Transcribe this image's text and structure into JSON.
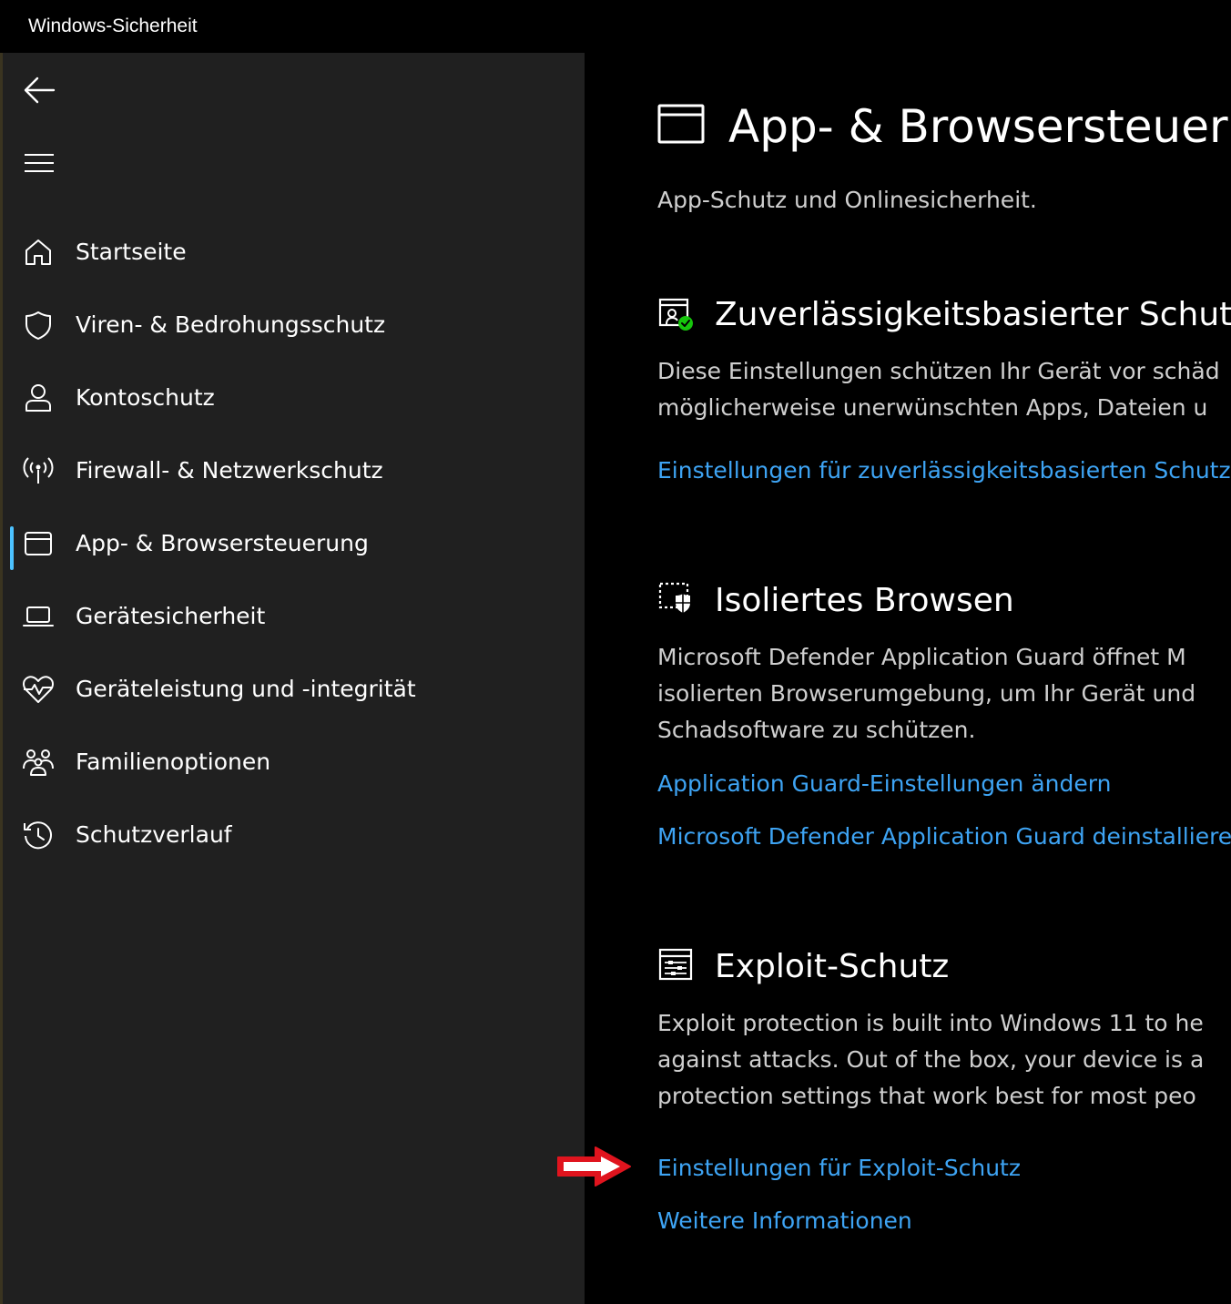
{
  "window": {
    "title": "Windows-Sicherheit"
  },
  "sidebar": {
    "back_icon": "arrow-left-icon",
    "menu_icon": "hamburger-icon",
    "items": [
      {
        "label": "Startseite",
        "icon": "home-icon"
      },
      {
        "label": "Viren- & Bedrohungsschutz",
        "icon": "shield-icon"
      },
      {
        "label": "Kontoschutz",
        "icon": "person-icon"
      },
      {
        "label": "Firewall- & Netzwerkschutz",
        "icon": "antenna-icon"
      },
      {
        "label": "App- & Browsersteuerung",
        "icon": "app-window-icon",
        "selected": true
      },
      {
        "label": "Gerätesicherheit",
        "icon": "laptop-icon"
      },
      {
        "label": "Geräteleistung und -integrität",
        "icon": "heart-pulse-icon"
      },
      {
        "label": "Familienoptionen",
        "icon": "family-icon"
      },
      {
        "label": "Schutzverlauf",
        "icon": "history-icon"
      }
    ],
    "accent_color": "#4cc2ff"
  },
  "page": {
    "title": "App- & Browsersteuerung",
    "subtitle": "App-Schutz und Onlinesicherheit."
  },
  "sections": {
    "reputation": {
      "title": "Zuverlässigkeitsbasierter Schutz",
      "desc_lines": [
        "Diese Einstellungen schützen Ihr Gerät vor schäd",
        "möglicherweise unerwünschten Apps, Dateien u"
      ],
      "link": "Einstellungen für zuverlässigkeitsbasierten Schutz",
      "status_color": "#16c60c"
    },
    "isolated": {
      "title": "Isoliertes Browsen",
      "desc_lines": [
        "Microsoft Defender Application Guard öffnet M",
        "isolierten Browserumgebung, um Ihr Gerät und",
        "Schadsoftware zu schützen."
      ],
      "links": [
        "Application Guard-Einstellungen ändern",
        "Microsoft Defender Application Guard deinstalliere"
      ]
    },
    "exploit": {
      "title": "Exploit-Schutz",
      "desc_lines": [
        "Exploit protection is built into Windows 11 to he",
        "against attacks.  Out of the box, your device is a",
        "protection settings that work best for most peo"
      ],
      "links": [
        "Einstellungen für Exploit-Schutz",
        "Weitere Informationen"
      ]
    }
  },
  "link_color": "#3ea4f4",
  "annotation_arrow_color": "#e0141e"
}
